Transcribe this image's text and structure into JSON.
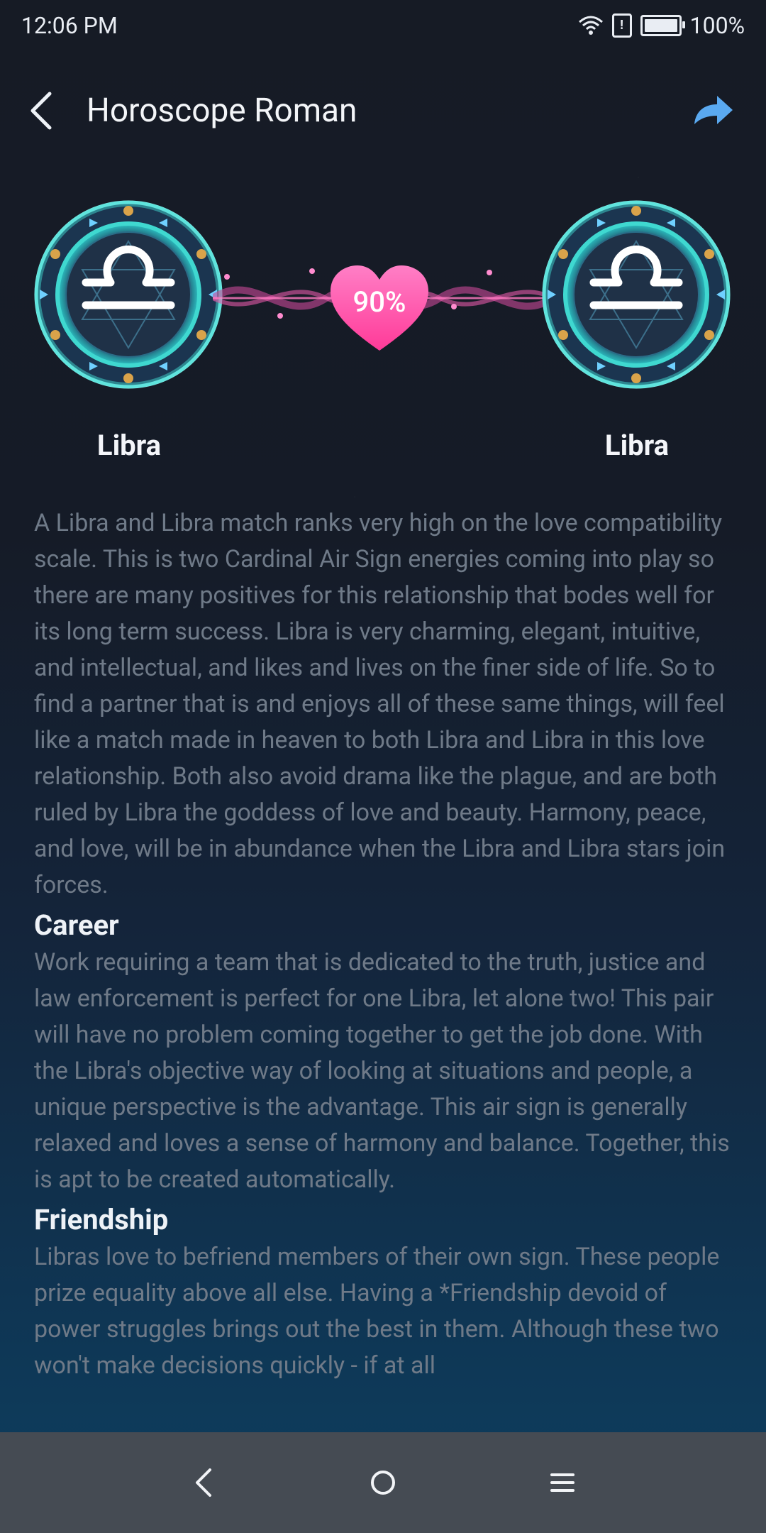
{
  "status_bar": {
    "time": "12:06 PM",
    "battery_percent": "100%",
    "icons": [
      "wifi-icon",
      "alert-icon",
      "battery-icon"
    ]
  },
  "header": {
    "title": "Horoscope Roman",
    "back_icon": "back-arrow-icon",
    "share_icon": "share-icon"
  },
  "match": {
    "left_sign": "Libra",
    "right_sign": "Libra",
    "compatibility": "90%",
    "accent_color": "#ff4fa3",
    "wheel_color": "#3fd8d0"
  },
  "sections": {
    "intro": "A Libra and Libra match ranks very high on the love compatibility scale. This is two Cardinal Air Sign energies coming into play so there are many positives for this relationship that bodes well for its long term success. Libra is very charming, elegant, intuitive, and intellectual, and likes and lives on the finer side of life. So to find a partner that is and enjoys all of these same things, will feel like a match made in heaven to both Libra and Libra in this love relationship. Both also avoid drama like the plague, and are both ruled by Libra the goddess of love and beauty. Harmony, peace, and love, will be in abundance when the Libra and Libra stars join forces.",
    "career_heading": "Career",
    "career_text": "Work requiring a team that is dedicated to the truth, justice and law enforcement is perfect for one Libra, let alone two! This pair will have no problem coming together to get the job done. With the Libra's objective way of looking at situations and people, a unique perspective is the advantage. This air sign is generally relaxed and loves a sense of harmony and balance. Together, this is apt to be created automatically.",
    "friendship_heading": "Friendship",
    "friendship_text": "Libras love to befriend members of their own sign. These people prize equality above all else. Having a *Friendship devoid of power struggles brings out the best in them. Although these two won't make decisions quickly - if at all"
  },
  "nav_bar": {
    "buttons": [
      "back-icon",
      "home-icon",
      "menu-icon"
    ]
  }
}
